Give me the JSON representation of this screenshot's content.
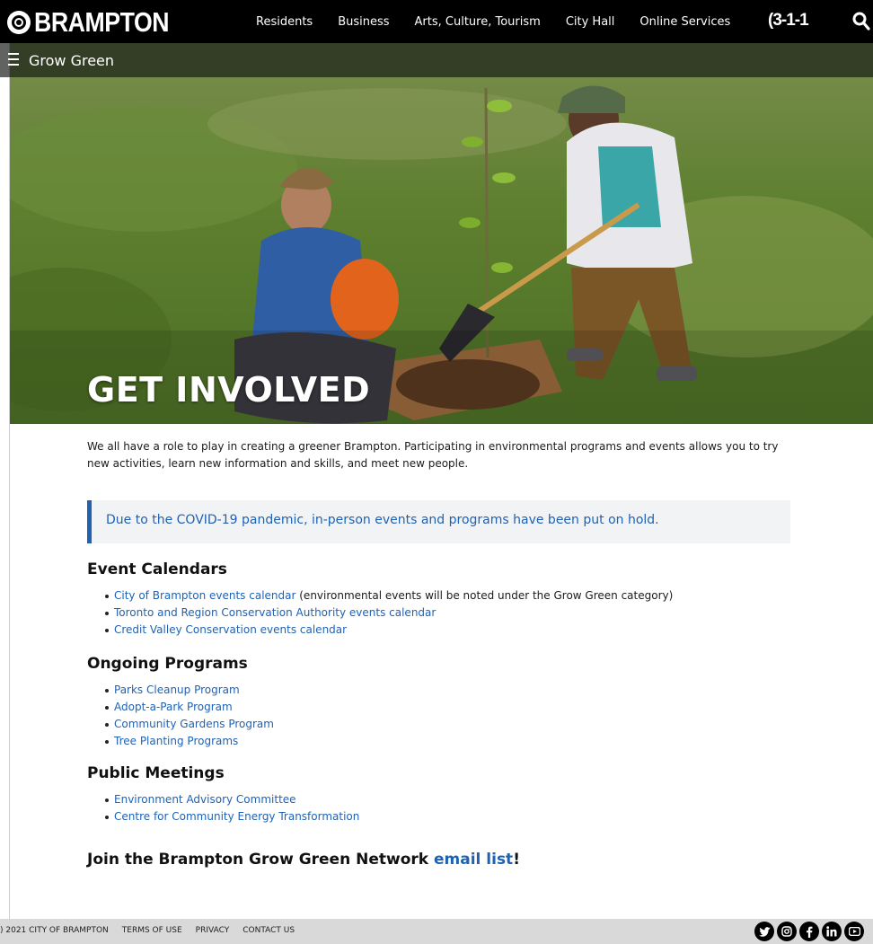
{
  "header": {
    "logo_text": "BRAMPTON",
    "nav": [
      "Residents",
      "Business",
      "Arts, Culture, Tourism",
      "City Hall",
      "Online Services"
    ],
    "hotline": "(3-1-1"
  },
  "subnav": {
    "title": "Grow Green"
  },
  "hero": {
    "title": "GET INVOLVED"
  },
  "main": {
    "intro": "We all have a role to play in creating a greener Brampton. Participating in environmental programs and events allows you to try new activities, learn new information and skills, and meet new people.",
    "notice": "Due to the COVID-19 pandemic, in-person events and programs have been put on hold.",
    "sections": [
      {
        "heading": "Event Calendars",
        "items": [
          {
            "link": "City of Brampton events calendar",
            "suffix": " (environmental events will be noted under the Grow Green category)"
          },
          {
            "link": "Toronto and Region Conservation Authority events calendar",
            "suffix": ""
          },
          {
            "link": "Credit Valley Conservation events calendar",
            "suffix": ""
          }
        ]
      },
      {
        "heading": "Ongoing Programs",
        "items": [
          {
            "link": "Parks Cleanup Program"
          },
          {
            "link": "Adopt-a-Park Program"
          },
          {
            "link": "Community Gardens Program"
          },
          {
            "link": "Tree Planting Programs"
          }
        ]
      },
      {
        "heading": "Public Meetings",
        "items": [
          {
            "link": "Environment Advisory Committee"
          },
          {
            "link": "Centre for Community Energy Transformation"
          }
        ]
      }
    ],
    "join": {
      "prefix": "Join the Brampton Grow Green Network ",
      "link": "email list",
      "suffix": "!"
    }
  },
  "footer": {
    "copyright": ") 2021 CITY OF BRAMPTON",
    "links": [
      "TERMS OF USE",
      "PRIVACY",
      "CONTACT US"
    ],
    "social": [
      "twitter-icon",
      "instagram-icon",
      "facebook-icon",
      "linkedin-icon",
      "youtube-icon"
    ]
  },
  "colors": {
    "link": "#1f62b4",
    "nav_bg": "#000000",
    "notice_bg": "#f2f3f4",
    "footer_bg": "#d9d9d9"
  }
}
